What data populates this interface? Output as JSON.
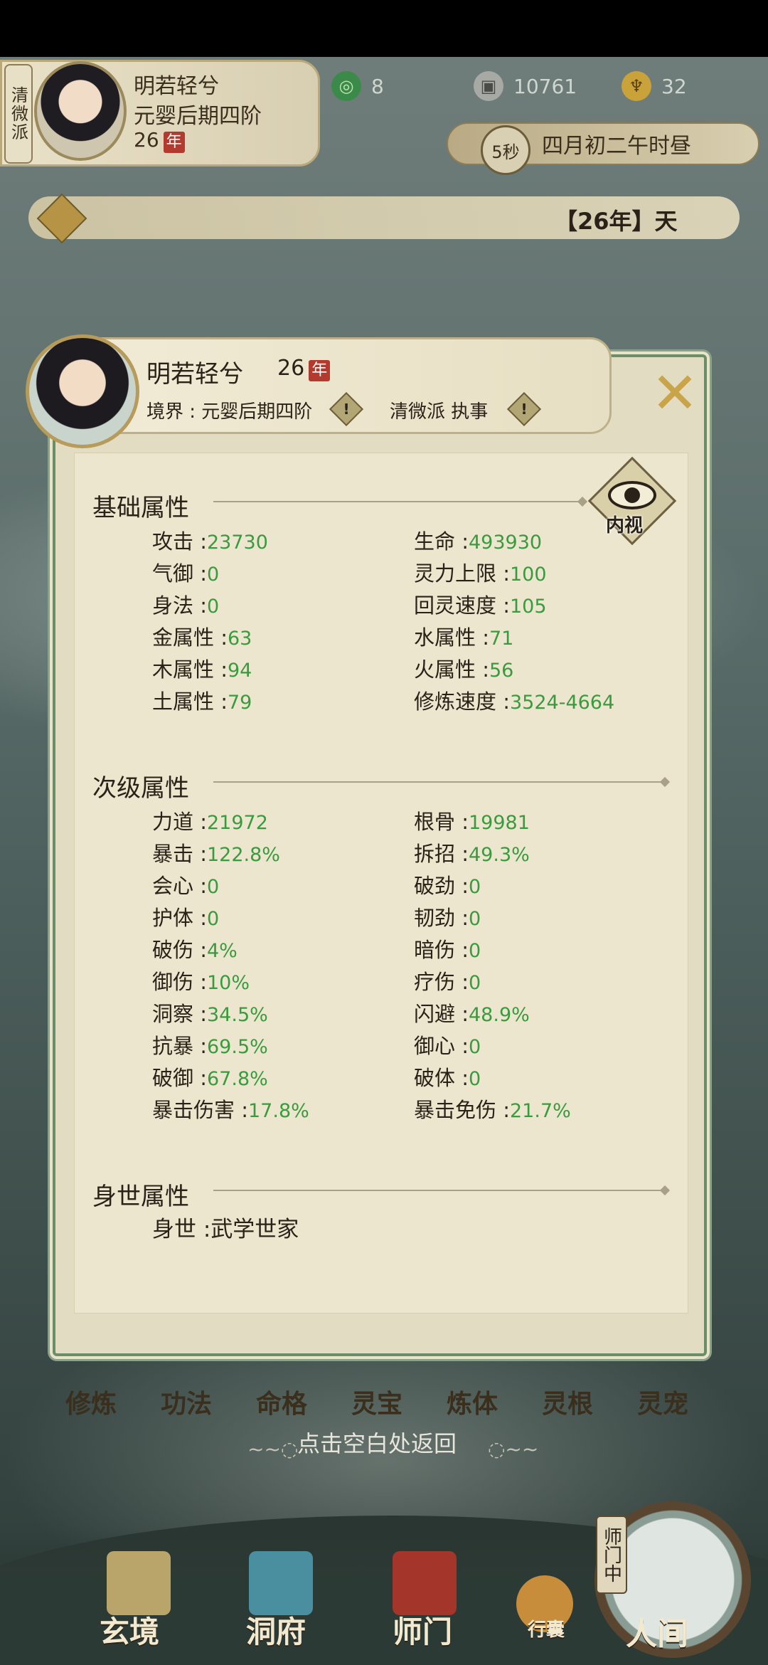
{
  "hud": {
    "sect": "清微派",
    "name": "明若轻兮",
    "realm": "元婴后期四阶",
    "age": "26",
    "age_unit": "年",
    "resource_1": "8",
    "resource_2": "10761",
    "resource_3": "32",
    "timer": "5秒",
    "calendar": "四月初二午时昼",
    "notice": "【26年】天"
  },
  "profile": {
    "name": "明若轻兮",
    "age": "26",
    "age_unit": "年",
    "realm": "境界 : 元婴后期四阶",
    "sect": "清微派 执事"
  },
  "inner_view_label": "内视",
  "basic": {
    "title": "基础属性",
    "left": [
      {
        "label": "攻击 :",
        "value": "23730"
      },
      {
        "label": "气御 :",
        "value": "0"
      },
      {
        "label": "身法 :",
        "value": "0"
      },
      {
        "label": "金属性 :",
        "value": "63"
      },
      {
        "label": "木属性 :",
        "value": "94"
      },
      {
        "label": "土属性 :",
        "value": "79"
      }
    ],
    "right": [
      {
        "label": "生命 :",
        "value": "493930"
      },
      {
        "label": "灵力上限 :",
        "value": "100"
      },
      {
        "label": "回灵速度 :",
        "value": "105"
      },
      {
        "label": "水属性 :",
        "value": "71"
      },
      {
        "label": "火属性 :",
        "value": "56"
      },
      {
        "label": "修炼速度 :",
        "value": "3524-4664"
      }
    ]
  },
  "secondary": {
    "title": "次级属性",
    "left": [
      {
        "label": "力道 :",
        "value": "21972"
      },
      {
        "label": "暴击 :",
        "value": "122.8%"
      },
      {
        "label": "会心 :",
        "value": "0"
      },
      {
        "label": "护体 :",
        "value": "0"
      },
      {
        "label": "破伤 :",
        "value": "4%"
      },
      {
        "label": "御伤 :",
        "value": "10%"
      },
      {
        "label": "洞察 :",
        "value": "34.5%"
      },
      {
        "label": "抗暴 :",
        "value": "69.5%"
      },
      {
        "label": "破御 :",
        "value": "67.8%"
      },
      {
        "label": "暴击伤害 :",
        "value": "17.8%"
      }
    ],
    "right": [
      {
        "label": "根骨 :",
        "value": "19981"
      },
      {
        "label": "拆招 :",
        "value": "49.3%"
      },
      {
        "label": "破劲 :",
        "value": "0"
      },
      {
        "label": "韧劲 :",
        "value": "0"
      },
      {
        "label": "暗伤 :",
        "value": "0"
      },
      {
        "label": "疗伤 :",
        "value": "0"
      },
      {
        "label": "闪避 :",
        "value": "48.9%"
      },
      {
        "label": "御心 :",
        "value": "0"
      },
      {
        "label": "破体 :",
        "value": "0"
      },
      {
        "label": "暴击免伤 :",
        "value": "21.7%"
      }
    ]
  },
  "background": {
    "title": "身世属性",
    "label": "身世 :",
    "value": "武学世家"
  },
  "skills": [
    "修炼",
    "功法",
    "命格",
    "灵宝",
    "炼体",
    "灵根",
    "灵宠"
  ],
  "back_hint": "点击空白处返回",
  "nav": {
    "xuanjing": "玄境",
    "dongfu": "洞府",
    "shimen": "师门",
    "xingnang": "行囊",
    "renjian": "人间",
    "shimen_tag": "师门中"
  }
}
